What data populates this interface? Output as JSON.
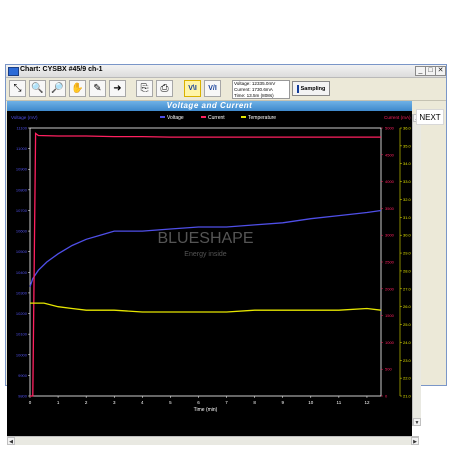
{
  "window": {
    "title": "Chart: CYSBX #45/9 ch-1",
    "minimize": "_",
    "maximize": "□",
    "close": "✕"
  },
  "toolbar": {
    "buttons": [
      "reset-zoom",
      "zoom-in",
      "zoom-out",
      "pan",
      "draw",
      "export",
      "copy",
      "print"
    ],
    "vr_label": "V\\I",
    "vi_label": "V/I",
    "info": {
      "voltage": "Voltage: 12335.0mV",
      "current": "Current: 1730.6mA",
      "time": "Time:    13.5m (808s)"
    },
    "sampling_label": "Sampling"
  },
  "chart_data": {
    "type": "line",
    "title": "Voltage and Current",
    "xlabel": "Time (min)",
    "xlim": [
      0,
      12.5
    ],
    "x_ticks": [
      0,
      1,
      2,
      3,
      4,
      5,
      6,
      7,
      8,
      9,
      10,
      11,
      12
    ],
    "left_axis": {
      "label": "Voltage (mV)",
      "ylim": [
        9800,
        11100
      ],
      "ticks": [
        9800,
        9900,
        10000,
        10100,
        10200,
        10300,
        10400,
        10500,
        10600,
        10700,
        10800,
        10900,
        11000,
        11100
      ]
    },
    "right_axis_current": {
      "label": "Current (mA)",
      "ylim": [
        0,
        5000
      ],
      "ticks": [
        0,
        500,
        1000,
        1500,
        2000,
        2500,
        3000,
        3500,
        4000,
        4500,
        5000
      ]
    },
    "right_axis_temperature": {
      "label": "",
      "ylim": [
        21,
        36
      ],
      "ticks": [
        21,
        22,
        23,
        24,
        25,
        26,
        27,
        28,
        29,
        30,
        31,
        32,
        33,
        34,
        35,
        36
      ]
    },
    "legend": [
      "Voltage",
      "Current",
      "Temperature"
    ],
    "series": [
      {
        "name": "Voltage",
        "axis": "left",
        "color": "#4f4fe8",
        "x": [
          0,
          0.1,
          0.3,
          0.6,
          1,
          1.5,
          2,
          2.5,
          3,
          3.5,
          4,
          5,
          6,
          7,
          8,
          9,
          10,
          11,
          12,
          12.5
        ],
        "y": [
          10330,
          10370,
          10410,
          10450,
          10490,
          10530,
          10560,
          10580,
          10600,
          10600,
          10600,
          10610,
          10620,
          10620,
          10630,
          10640,
          10660,
          10675,
          10690,
          10700
        ]
      },
      {
        "name": "Current",
        "axis": "current",
        "color": "#ff2060",
        "x": [
          0,
          0.1,
          0.2,
          0.3,
          1,
          2,
          3,
          4,
          5,
          6,
          7,
          8,
          9,
          10,
          11,
          12,
          12.5
        ],
        "y": [
          0,
          0,
          4900,
          4860,
          4850,
          4850,
          4840,
          4840,
          4830,
          4830,
          4830,
          4830,
          4830,
          4830,
          4830,
          4830,
          4830
        ]
      },
      {
        "name": "Temperature",
        "axis": "temperature",
        "color": "#e6e600",
        "x": [
          0,
          0.5,
          1,
          1.5,
          2,
          3,
          4,
          5,
          6,
          7,
          8,
          9,
          10,
          11,
          12,
          12.5
        ],
        "y": [
          26.2,
          26.2,
          26.0,
          25.9,
          25.8,
          25.8,
          25.7,
          25.7,
          25.7,
          25.7,
          25.8,
          25.8,
          25.8,
          25.8,
          25.9,
          25.8
        ]
      }
    ],
    "grid": false,
    "watermark": "BLUESHAPE Energy inside"
  },
  "side": {
    "next_label": "NEXT"
  }
}
